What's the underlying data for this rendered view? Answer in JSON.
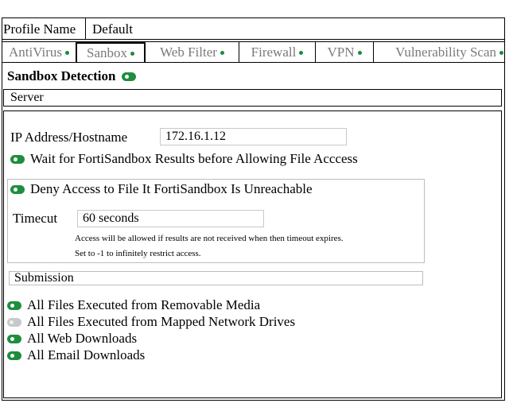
{
  "profile": {
    "label": "Profile Name",
    "value": "Default"
  },
  "tabs": [
    {
      "label": "AntiVirus",
      "active": false
    },
    {
      "label": "Sanbox",
      "active": true
    },
    {
      "label": "Web Filter",
      "active": false
    },
    {
      "label": "Firewall",
      "active": false
    },
    {
      "label": "VPN",
      "active": false
    },
    {
      "label": "Vulnerability Scan",
      "active": false
    }
  ],
  "section": {
    "title": "Sandbox Detection",
    "enabled": true
  },
  "server": {
    "header": "Server",
    "ip_label": "IP Address/Hostname",
    "ip_value": "172.16.1.12",
    "wait_label": "Wait for FortiSandbox Results before Allowing File Acccess",
    "wait_enabled": true,
    "deny_label": "Deny Access to File It FortiSandbox Is Unreachable",
    "deny_enabled": true,
    "timeout_label": "Timecut",
    "timeout_value": "60 seconds",
    "note_line1": "Access will be allowed if results are not received when then timeout expires.",
    "note_line2": "Set to -1 to infinitely restrict  access."
  },
  "submission": {
    "header": "Submission",
    "items": [
      {
        "label": "All Files Executed from Removable Media",
        "enabled": true
      },
      {
        "label": "All Files Executed from Mapped Network Drives",
        "enabled": false
      },
      {
        "label": "All Web Downloads",
        "enabled": true
      },
      {
        "label": "All Email Downloads",
        "enabled": true
      }
    ]
  },
  "colors": {
    "toggle_on": "#1e8e3e",
    "toggle_off": "#c8c8c8",
    "tab_text": "#7a7a7a"
  },
  "icons": {
    "toggle": "toggle-switch-icon",
    "tab_indicator": "status-dot-icon"
  }
}
